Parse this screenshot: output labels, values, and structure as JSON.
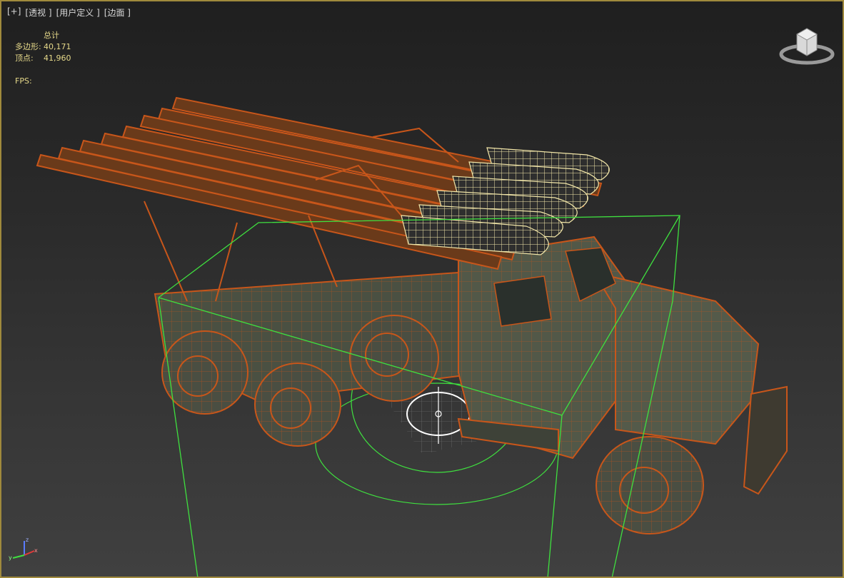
{
  "viewport": {
    "labels": [
      "[+]",
      "[透视 ]",
      "[用户定义 ]",
      "[边面 ]"
    ]
  },
  "stats": {
    "header": "总计",
    "polygons_label": "多边形:",
    "polygons_value": "40,171",
    "vertices_label": "顶点:",
    "vertices_value": "41,960",
    "fps_label": "FPS:"
  },
  "viewcube": {
    "icon": "viewcube-icon"
  },
  "axis": {
    "x": "x",
    "y": "y",
    "z": "z"
  },
  "colors": {
    "frame_border": "#a08a3c",
    "stats_text": "#e6d98a",
    "wireframe": "#c8561a",
    "selected": "#f2e6a8",
    "gizmo": "#3fe03f",
    "body": "#4e5444"
  }
}
